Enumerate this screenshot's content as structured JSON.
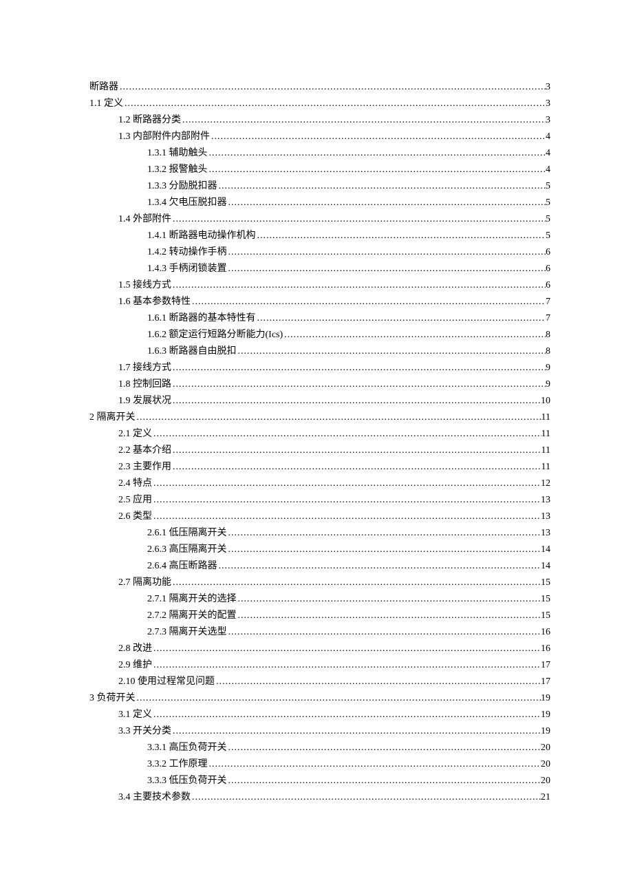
{
  "toc": [
    {
      "level": 0,
      "label": "断路器",
      "page": "3"
    },
    {
      "level": 0,
      "label": "1.1  定义",
      "page": "3"
    },
    {
      "level": 1,
      "label": "1.2 断路器分类",
      "page": "3"
    },
    {
      "level": 1,
      "label": "1.3  内部附件内部附件",
      "page": "4"
    },
    {
      "level": 2,
      "label": "1.3.1  辅助触头",
      "page": "4"
    },
    {
      "level": 2,
      "label": "1.3.2  报警触头",
      "page": "4"
    },
    {
      "level": 2,
      "label": "1.3.3  分励脱扣器",
      "page": "5"
    },
    {
      "level": 2,
      "label": "1.3.4  欠电压脱扣器",
      "page": "5"
    },
    {
      "level": 1,
      "label": "1.4  外部附件",
      "page": "5"
    },
    {
      "level": 2,
      "label": "1.4.1  断路器电动操作机构",
      "page": "5"
    },
    {
      "level": 2,
      "label": "1.4.2  转动操作手柄",
      "page": "6"
    },
    {
      "level": 2,
      "label": "1.4.3  手柄闭锁装置",
      "page": "6"
    },
    {
      "level": 1,
      "label": "1.5  接线方式",
      "page": "6"
    },
    {
      "level": 1,
      "label": "1.6  基本参数特性",
      "page": "7"
    },
    {
      "level": 2,
      "label": "1.6.1  断路器的基本特性有",
      "page": "7"
    },
    {
      "level": 2,
      "label": "1.6.2  额定运行短路分断能力(Ics)",
      "page": "8"
    },
    {
      "level": 2,
      "label": "1.6.3  断路器自由脱扣",
      "page": "8"
    },
    {
      "level": 1,
      "label": "1.7  接线方式",
      "page": "9"
    },
    {
      "level": 1,
      "label": "1.8  控制回路",
      "page": "9"
    },
    {
      "level": 1,
      "label": "1.9  发展状况",
      "page": "10"
    },
    {
      "level": 0,
      "label": "2  隔离开关",
      "page": "11"
    },
    {
      "level": 1,
      "label": "2.1  定义",
      "page": "11"
    },
    {
      "level": 1,
      "label": "2.2  基本介绍",
      "page": "11"
    },
    {
      "level": 1,
      "label": "2.3  主要作用",
      "page": "11"
    },
    {
      "level": 1,
      "label": "2.4  特点",
      "page": "12"
    },
    {
      "level": 1,
      "label": "2.5  应用",
      "page": "13"
    },
    {
      "level": 1,
      "label": "2.6  类型",
      "page": "13"
    },
    {
      "level": 2,
      "label": "2.6.1  低压隔离开关",
      "page": "13"
    },
    {
      "level": 2,
      "label": "2.6.3  高压隔离开关",
      "page": "14"
    },
    {
      "level": 2,
      "label": "2.6.4  高压断路器",
      "page": "14"
    },
    {
      "level": 1,
      "label": "2.7  隔离功能",
      "page": "15"
    },
    {
      "level": 2,
      "label": "2.7.1  隔离开关的选择",
      "page": "15"
    },
    {
      "level": 2,
      "label": "2.7.2  隔离开关的配置",
      "page": "15"
    },
    {
      "level": 2,
      "label": "2.7.3  隔离开关选型",
      "page": "16"
    },
    {
      "level": 1,
      "label": "2.8  改进",
      "page": "16"
    },
    {
      "level": 1,
      "label": "2.9  维护",
      "page": "17"
    },
    {
      "level": 1,
      "label": "2.10  使用过程常见问题",
      "page": "17"
    },
    {
      "level": 0,
      "label": "3  负荷开关",
      "page": "19"
    },
    {
      "level": 1,
      "label": "3.1  定义",
      "page": "19"
    },
    {
      "level": 1,
      "label": "3.3  开关分类",
      "page": "19"
    },
    {
      "level": 2,
      "label": "3.3.1  高压负荷开关",
      "page": "20"
    },
    {
      "level": 2,
      "label": "3.3.2  工作原理",
      "page": "20"
    },
    {
      "level": 2,
      "label": "3.3.3  低压负荷开关",
      "page": "20"
    },
    {
      "level": 1,
      "label": "3.4  主要技术参数",
      "page": "21"
    }
  ]
}
